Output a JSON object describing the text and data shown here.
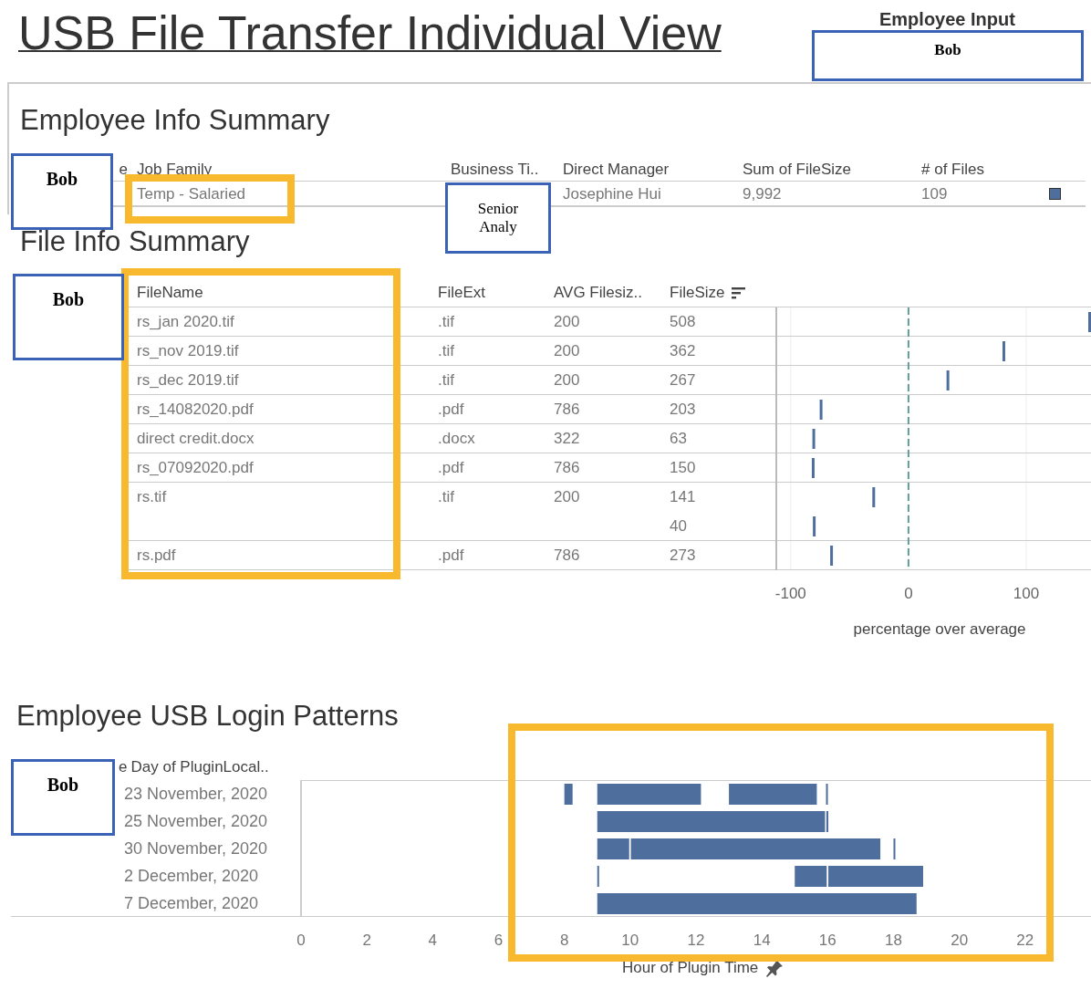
{
  "title": "USB File Transfer Individual View",
  "employee_input": {
    "label": "Employee Input",
    "redaction": "Bob"
  },
  "employee_info": {
    "title": "Employee Info Summary",
    "columns": [
      "e",
      "Job Family",
      "Business Ti..",
      "Direct Manager",
      "Sum of FileSize",
      "# of Files"
    ],
    "row": {
      "job_family": "Temp - Salaried",
      "direct_manager": "Josephine Hui",
      "sum_filesize": "9,992",
      "file_count": "109"
    },
    "name_redaction": "Bob",
    "business_title_redaction": "Senior Analy",
    "job_family_highlighted": true
  },
  "file_info": {
    "title": "File Info Summary",
    "columns": [
      {
        "label": "FileName",
        "sorted": false
      },
      {
        "label": "FileExt",
        "sorted": false
      },
      {
        "label": "AVG Filesiz..",
        "sorted": false
      },
      {
        "label": "FileSize",
        "sorted": true
      }
    ],
    "rows": [
      {
        "file_name": "rs_jan 2020.tif",
        "file_ext": ".tif",
        "avg_filesize": "200",
        "file_sizes": [
          "508"
        ]
      },
      {
        "file_name": "rs_nov 2019.tif",
        "file_ext": ".tif",
        "avg_filesize": "200",
        "file_sizes": [
          "362"
        ]
      },
      {
        "file_name": "rs_dec 2019.tif",
        "file_ext": ".tif",
        "avg_filesize": "200",
        "file_sizes": [
          "267"
        ]
      },
      {
        "file_name": "rs_14082020.pdf",
        "file_ext": ".pdf",
        "avg_filesize": "786",
        "file_sizes": [
          "203"
        ]
      },
      {
        "file_name": "direct credit.docx",
        "file_ext": ".docx",
        "avg_filesize": "322",
        "file_sizes": [
          "63"
        ]
      },
      {
        "file_name": "rs_07092020.pdf",
        "file_ext": ".pdf",
        "avg_filesize": "786",
        "file_sizes": [
          "150"
        ]
      },
      {
        "file_name": "rs.tif",
        "file_ext": ".tif",
        "avg_filesize": "200",
        "file_sizes": [
          "141",
          "40"
        ]
      },
      {
        "file_name": "rs.pdf",
        "file_ext": ".pdf",
        "avg_filesize": "786",
        "file_sizes": [
          "273"
        ]
      }
    ],
    "redaction": "Bob",
    "file_name_highlighted": true,
    "axis_ticks": [
      "-100",
      "0",
      "100"
    ],
    "axis_title": "percentage over average"
  },
  "login_patterns": {
    "title": "Employee USB Login Patterns",
    "cut_header": "e",
    "column": "Day of PluginLocal..",
    "redaction": "Bob",
    "chart_highlighted": true,
    "axis_title": "Hour of Plugin Time",
    "dates": [
      "23 November, 2020",
      "25 November, 2020",
      "30 November, 2020",
      "2 December, 2020",
      "7 December, 2020"
    ],
    "hour_ticks": [
      "0",
      "2",
      "4",
      "6",
      "8",
      "10",
      "12",
      "14",
      "16",
      "18",
      "20",
      "22"
    ]
  }
}
